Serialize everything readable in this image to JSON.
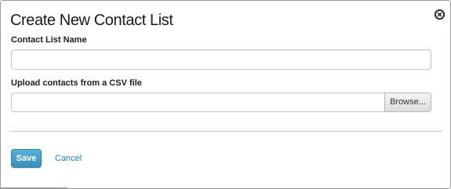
{
  "dialog": {
    "title": "Create New Contact List",
    "close_icon": "close-circle-icon"
  },
  "form": {
    "name_label": "Contact List Name",
    "name_value": "",
    "name_placeholder": "",
    "csv_label": "Upload contacts from a CSV file",
    "csv_value": "",
    "browse_label": "Browse..."
  },
  "actions": {
    "save_label": "Save",
    "cancel_label": "Cancel"
  },
  "colors": {
    "primary": "#3a8dbb",
    "link": "#2a7dab",
    "border": "#c6c6c6"
  }
}
